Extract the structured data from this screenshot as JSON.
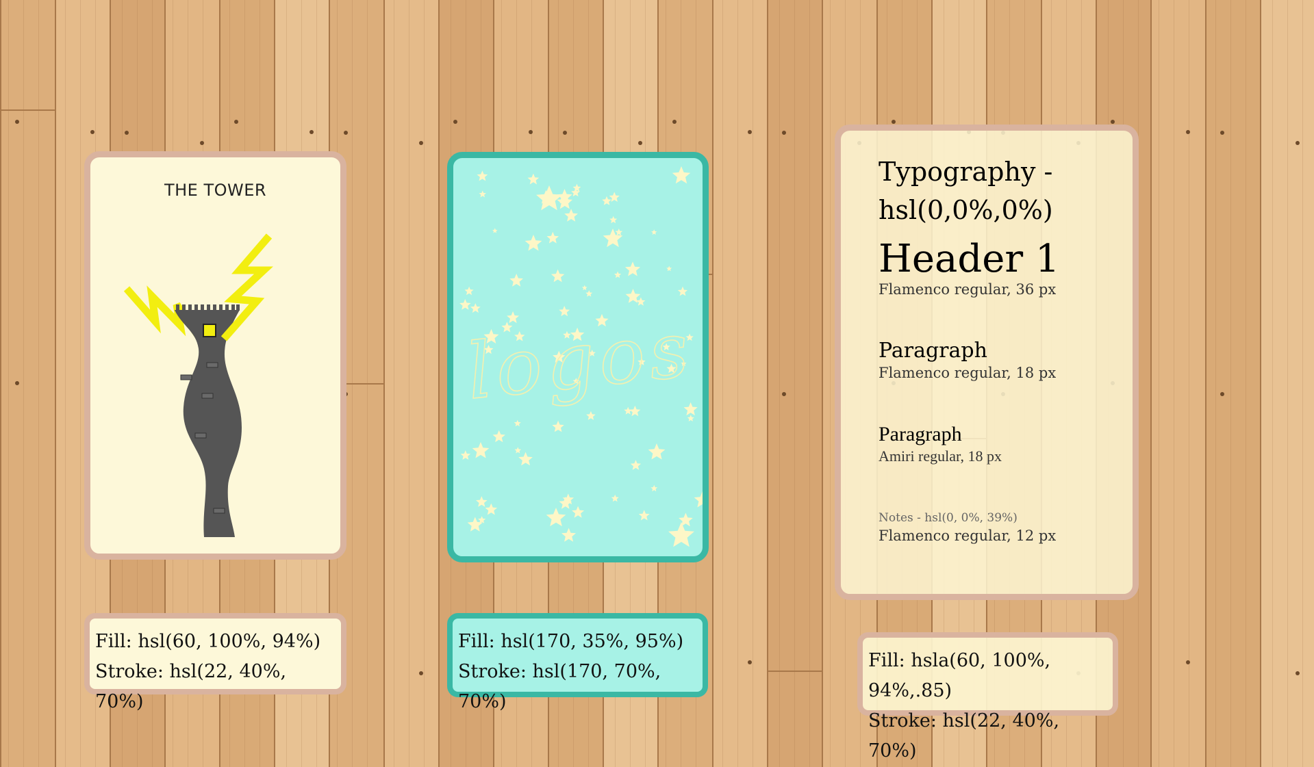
{
  "tower_card": {
    "title": "THE TOWER",
    "fill_color": "#fdf8d9",
    "stroke_color": "#d9b39f",
    "illustration": [
      "tower-icon",
      "lightning-bolt-icon",
      "window-icon"
    ]
  },
  "logo_card": {
    "script_text": "logos",
    "fill_color": "#a7f2e6",
    "stroke_color": "#3ab8a4",
    "illustration": [
      "star-icon"
    ]
  },
  "typography_card": {
    "title": "Typography - hsl(0,0%,0%)",
    "header_sample": "Header 1",
    "header_spec": "Flamenco regular, 36 px",
    "paragraph_sample": "Paragraph",
    "paragraph_spec": "Flamenco regular, 18 px",
    "paragraph2_sample": "Paragraph",
    "paragraph2_spec": "Amiri regular, 18 px",
    "notes_sample": "Notes - hsl(0, 0%, 39%)",
    "notes_spec": "Flamenco regular, 12 px"
  },
  "labels": {
    "tower": {
      "fill": "Fill: hsl(60, 100%, 94%)",
      "stroke": "Stroke: hsl(22, 40%, 70%)"
    },
    "logo": {
      "fill": "Fill: hsl(170, 35%, 95%)",
      "stroke": "Stroke: hsl(170, 70%, 70%)"
    },
    "typography": {
      "fill": "Fill: hsla(60, 100%, 94%,.85)",
      "stroke": "Stroke: hsl(22, 40%, 70%)"
    }
  },
  "colors": {
    "wood_base": "#e0b483",
    "tower_gray": "#555555",
    "lightning_yellow": "#f2ee10",
    "star_color": "#fdf7c7"
  }
}
